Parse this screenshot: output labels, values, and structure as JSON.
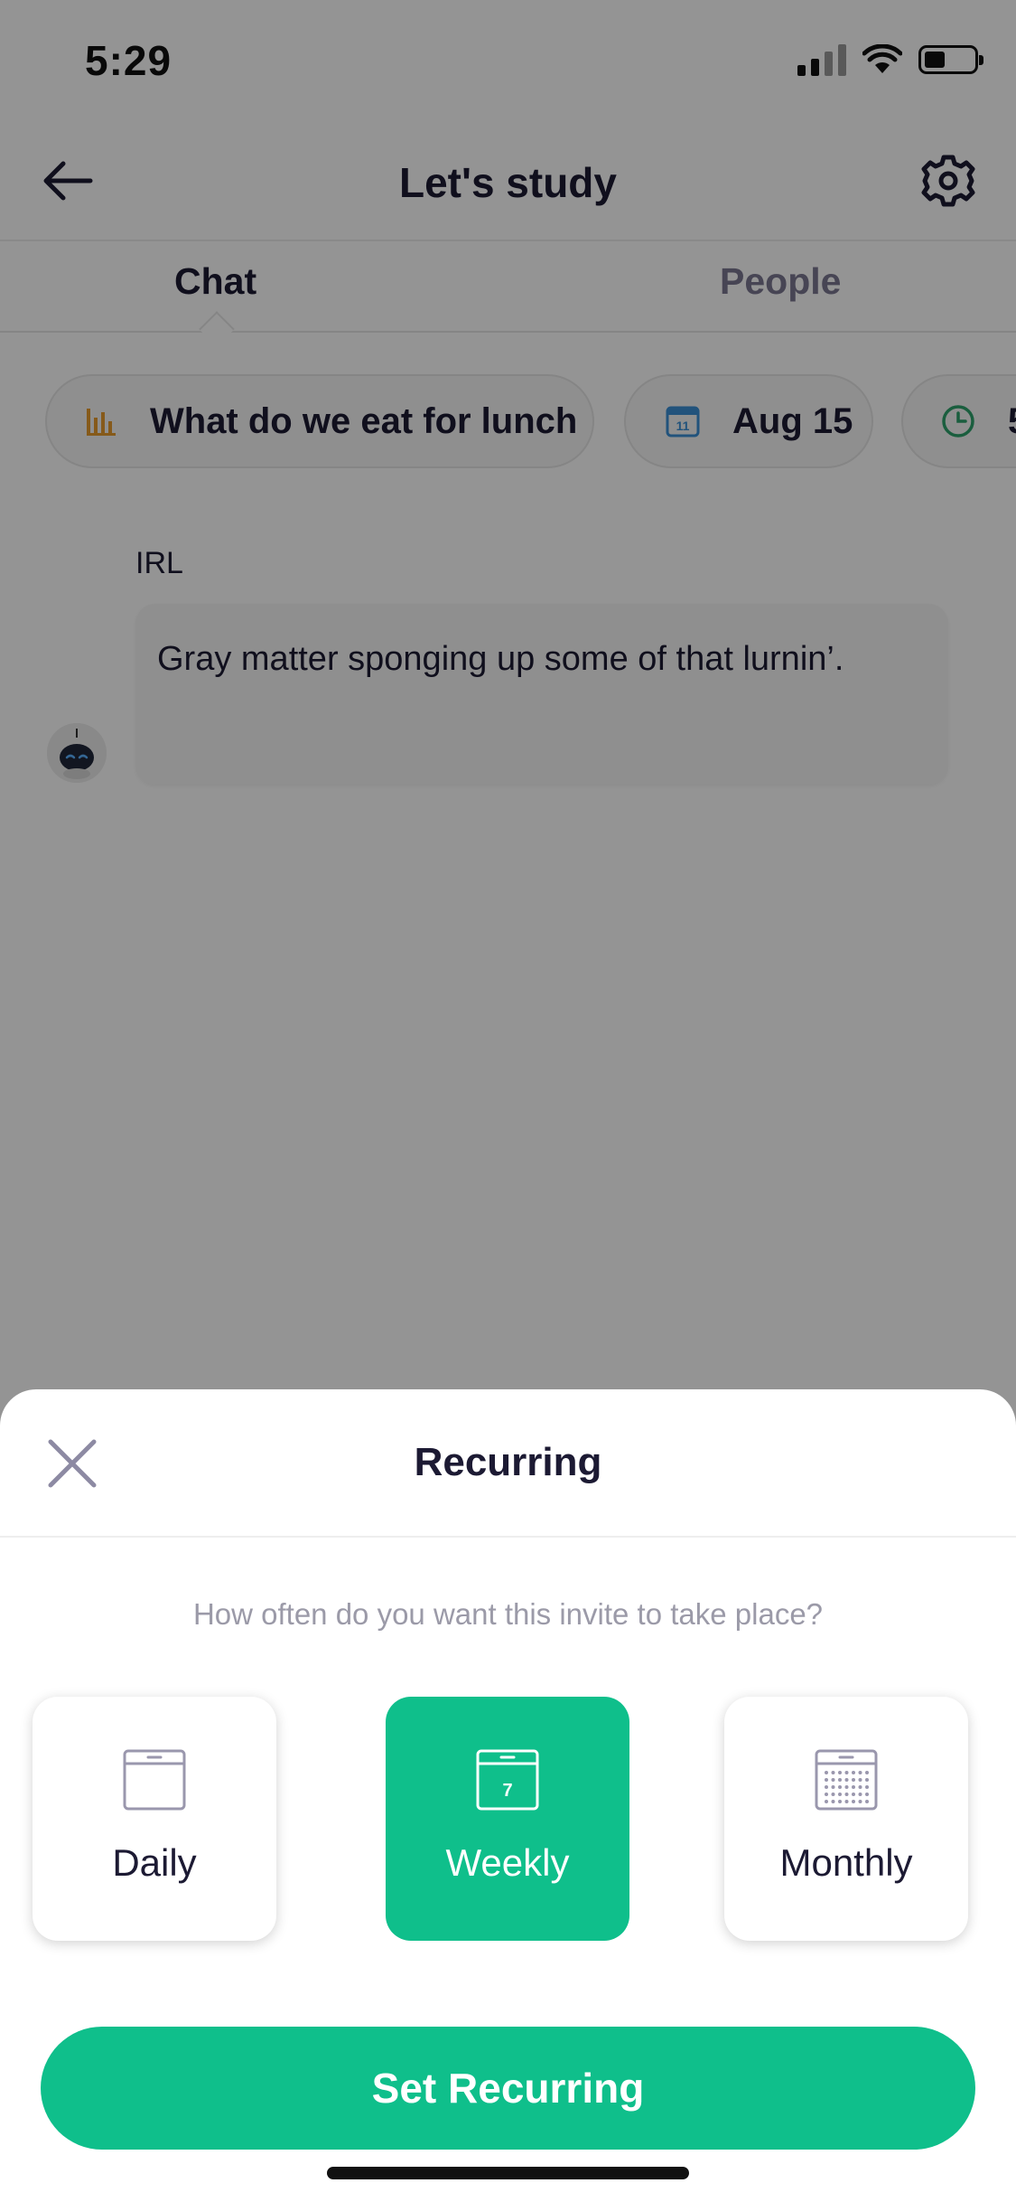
{
  "status_bar": {
    "time": "5:29"
  },
  "header": {
    "title": "Let's study"
  },
  "tabs": [
    {
      "label": "Chat"
    },
    {
      "label": "People"
    }
  ],
  "chips": [
    {
      "label": "What do we eat for lunch",
      "icon": "poll-icon"
    },
    {
      "label": "Aug 15",
      "icon": "calendar-icon",
      "icon_day": "11"
    },
    {
      "label": "5",
      "icon": "clock-icon"
    }
  ],
  "message": {
    "sender": "IRL",
    "text": "Gray matter sponging up some of that lurnin’."
  },
  "sheet": {
    "title": "Recurring",
    "question": "How often do you want this invite to take place?",
    "options": [
      {
        "label": "Daily",
        "selected": false
      },
      {
        "label": "Weekly",
        "selected": true,
        "icon_day": "7"
      },
      {
        "label": "Monthly",
        "selected": false
      }
    ],
    "button_label": "Set Recurring"
  },
  "colors": {
    "accent": "#0fbf8b",
    "text_dark": "#1c1a33",
    "text_muted": "#9b9aa8",
    "poll_orange": "#e79b2e",
    "calendar_blue": "#3b8fd6",
    "clock_green": "#2ea36b"
  }
}
